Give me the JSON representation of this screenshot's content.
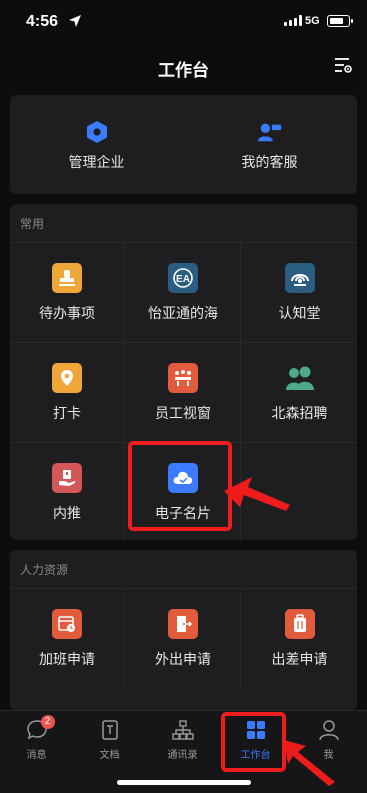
{
  "status": {
    "time": "4:56",
    "network": "5G",
    "battery_level": 0.75
  },
  "nav": {
    "title": "工作台",
    "settings_icon": "settings-list-icon"
  },
  "top_actions": [
    {
      "label": "管理企业",
      "icon": "hexagon-icon"
    },
    {
      "label": "我的客服",
      "icon": "customer-service-icon"
    }
  ],
  "common": {
    "title": "常用",
    "apps": [
      {
        "label": "待办事项",
        "icon": "stamp-icon",
        "color": "#f0a73a"
      },
      {
        "label": "怡亚通的海",
        "icon": "ea-logo-icon",
        "color": "#2b5d83"
      },
      {
        "label": "认知堂",
        "icon": "academy-icon",
        "color": "#2b5d83"
      },
      {
        "label": "打卡",
        "icon": "location-pin-icon",
        "color": "#f0a73a"
      },
      {
        "label": "员工视窗",
        "icon": "meeting-icon",
        "color": "#e25b3c"
      },
      {
        "label": "北森招聘",
        "icon": "people-icon",
        "color": "#4fa887"
      },
      {
        "label": "内推",
        "icon": "referral-icon",
        "color": "#d35658"
      },
      {
        "label": "电子名片",
        "icon": "cloud-icon",
        "color": "#3a7bff"
      }
    ]
  },
  "hr": {
    "title": "人力资源",
    "apps": [
      {
        "label": "加班申请",
        "icon": "calendar-clock-icon",
        "color": "#e25b3c"
      },
      {
        "label": "外出申请",
        "icon": "door-exit-icon",
        "color": "#e25b3c"
      },
      {
        "label": "出差申请",
        "icon": "luggage-icon",
        "color": "#e25b3c"
      }
    ]
  },
  "tabbar": {
    "tabs": [
      {
        "label": "消息",
        "icon": "chat-bubble-icon",
        "badge": "2"
      },
      {
        "label": "文档",
        "icon": "document-icon"
      },
      {
        "label": "通讯录",
        "icon": "org-chart-icon"
      },
      {
        "label": "工作台",
        "icon": "grid-icon"
      },
      {
        "label": "我",
        "icon": "person-icon"
      }
    ],
    "active": "工作台"
  }
}
